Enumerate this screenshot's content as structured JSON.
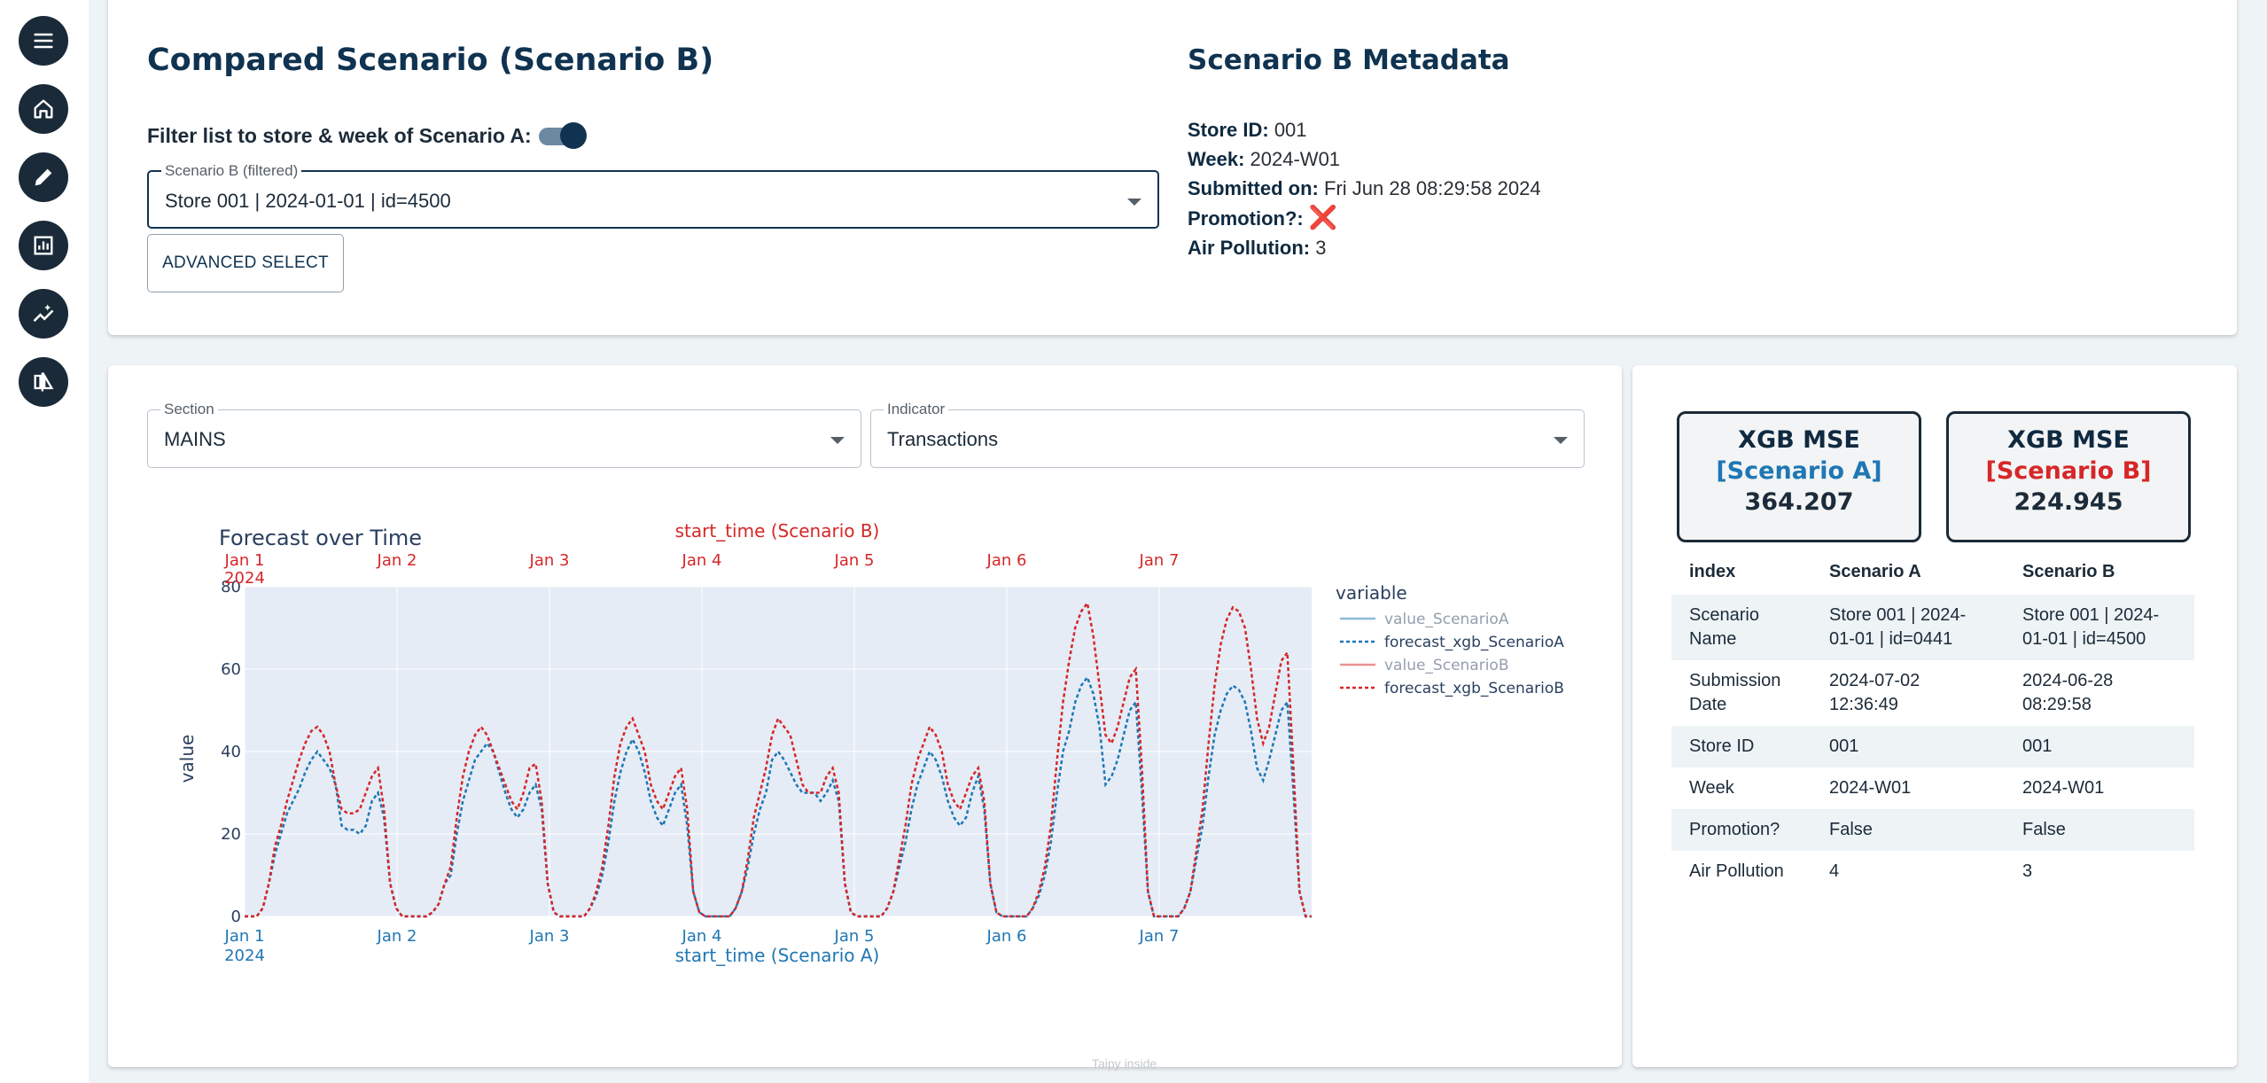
{
  "nav": {
    "items": [
      {
        "icon": "menu-icon"
      },
      {
        "icon": "home-icon"
      },
      {
        "icon": "pencil-icon"
      },
      {
        "icon": "report-icon"
      },
      {
        "icon": "sparkle-chart-icon"
      },
      {
        "icon": "compare-icon"
      }
    ]
  },
  "scenario_b": {
    "title": "Compared Scenario (Scenario B)",
    "filter_label": "Filter list to store & week of Scenario A:",
    "filter_on": true,
    "select_label": "Scenario B (filtered)",
    "select_value": "Store 001 | 2024-01-01 | id=4500",
    "advanced_button": "ADVANCED SELECT"
  },
  "metadata": {
    "title": "Scenario B Metadata",
    "fields": [
      {
        "key": "Store ID:",
        "value": "001"
      },
      {
        "key": "Week:",
        "value": "2024-W01"
      },
      {
        "key": "Submitted on:",
        "value": "Fri Jun 28 08:29:58 2024"
      },
      {
        "key": "Promotion?:",
        "value": "❌"
      },
      {
        "key": "Air Pollution:",
        "value": "3"
      }
    ]
  },
  "controls": {
    "section_label": "Section",
    "section_value": "MAINS",
    "indicator_label": "Indicator",
    "indicator_value": "Transactions"
  },
  "chart_data": {
    "type": "line",
    "title": "Forecast over Time",
    "xlabel_top": "start_time (Scenario B)",
    "xlabel_bottom": "start_time (Scenario A)",
    "ylabel": "value",
    "ylim": [
      0,
      80
    ],
    "yticks": [
      0,
      20,
      40,
      60,
      80
    ],
    "xticks": [
      "Jan 1",
      "Jan 2",
      "Jan 3",
      "Jan 4",
      "Jan 5",
      "Jan 6",
      "Jan 7"
    ],
    "xtick_year": "2024",
    "legend_title": "variable",
    "legend_position": "right",
    "grid": true,
    "colors": {
      "scenarioA": "#1f77b4",
      "scenarioB": "#d62728",
      "plot_bg": "#e5ecf6"
    },
    "series": [
      {
        "name": "value_ScenarioA",
        "dash": "solid",
        "color": "#1f77b4",
        "visible": false
      },
      {
        "name": "forecast_xgb_ScenarioA",
        "dash": "dot",
        "color": "#1f77b4",
        "visible": true,
        "values": [
          0,
          0,
          0,
          2,
          8,
          15,
          20,
          25,
          28,
          31,
          35,
          38,
          40,
          38,
          36,
          32,
          22,
          21,
          21,
          20,
          22,
          28,
          30,
          24,
          8,
          2,
          0,
          0,
          0,
          0,
          0,
          1,
          3,
          8,
          10,
          20,
          28,
          33,
          38,
          40,
          42,
          40,
          35,
          30,
          26,
          24,
          26,
          30,
          32,
          26,
          8,
          1,
          0,
          0,
          0,
          0,
          0,
          2,
          5,
          10,
          18,
          28,
          35,
          40,
          43,
          40,
          35,
          28,
          24,
          22,
          26,
          30,
          32,
          22,
          6,
          1,
          0,
          0,
          0,
          0,
          0,
          2,
          6,
          12,
          20,
          26,
          30,
          38,
          40,
          38,
          35,
          32,
          30,
          30,
          30,
          28,
          30,
          33,
          28,
          8,
          1,
          0,
          0,
          0,
          0,
          0,
          2,
          6,
          12,
          18,
          26,
          32,
          36,
          40,
          38,
          34,
          28,
          24,
          22,
          24,
          30,
          34,
          26,
          8,
          1,
          0,
          0,
          0,
          0,
          0,
          2,
          5,
          10,
          18,
          30,
          40,
          45,
          52,
          56,
          58,
          54,
          46,
          32,
          34,
          38,
          44,
          50,
          52,
          30,
          6,
          0,
          0,
          0,
          0,
          0,
          2,
          6,
          14,
          22,
          34,
          44,
          50,
          54,
          56,
          55,
          52,
          45,
          36,
          33,
          38,
          44,
          50,
          52,
          30,
          6,
          0,
          0
        ]
      },
      {
        "name": "value_ScenarioB",
        "dash": "solid",
        "color": "#d62728",
        "visible": false
      },
      {
        "name": "forecast_xgb_ScenarioB",
        "dash": "dot",
        "color": "#d62728",
        "visible": true,
        "values": [
          0,
          0,
          0,
          2,
          8,
          17,
          22,
          28,
          33,
          38,
          42,
          45,
          46,
          44,
          40,
          32,
          26,
          25,
          25,
          26,
          30,
          34,
          36,
          26,
          8,
          2,
          0,
          0,
          0,
          0,
          0,
          1,
          3,
          8,
          12,
          24,
          34,
          40,
          44,
          46,
          44,
          40,
          36,
          32,
          28,
          26,
          30,
          36,
          37,
          28,
          8,
          1,
          0,
          0,
          0,
          0,
          0,
          2,
          6,
          12,
          22,
          34,
          42,
          46,
          48,
          44,
          40,
          32,
          28,
          26,
          30,
          34,
          36,
          26,
          6,
          1,
          0,
          0,
          0,
          0,
          0,
          2,
          6,
          14,
          24,
          30,
          36,
          44,
          48,
          46,
          44,
          38,
          32,
          30,
          30,
          30,
          34,
          36,
          30,
          8,
          1,
          0,
          0,
          0,
          0,
          0,
          2,
          6,
          14,
          22,
          32,
          38,
          42,
          46,
          44,
          40,
          32,
          28,
          26,
          30,
          34,
          36,
          28,
          8,
          1,
          0,
          0,
          0,
          0,
          0,
          2,
          6,
          12,
          22,
          38,
          52,
          62,
          70,
          74,
          76,
          68,
          56,
          44,
          42,
          46,
          52,
          58,
          60,
          36,
          6,
          0,
          0,
          0,
          0,
          0,
          2,
          6,
          16,
          26,
          42,
          56,
          66,
          72,
          75,
          74,
          70,
          60,
          48,
          42,
          46,
          54,
          62,
          64,
          36,
          6,
          0,
          0
        ]
      }
    ]
  },
  "metrics": {
    "mse_label": "XGB MSE",
    "scenario_a_label": "[Scenario A]",
    "scenario_a_value": "364.207",
    "scenario_b_label": "[Scenario B]",
    "scenario_b_value": "224.945"
  },
  "comparison_table": {
    "headers": [
      "index",
      "Scenario A",
      "Scenario B"
    ],
    "rows": [
      [
        "Scenario Name",
        "Store 001 | 2024-01-01 | id=0441",
        "Store 001 | 2024-01-01 | id=4500"
      ],
      [
        "Submission Date",
        "2024-07-02 12:36:49",
        "2024-06-28 08:29:58"
      ],
      [
        "Store ID",
        "001",
        "001"
      ],
      [
        "Week",
        "2024-W01",
        "2024-W01"
      ],
      [
        "Promotion?",
        "False",
        "False"
      ],
      [
        "Air Pollution",
        "4",
        "3"
      ]
    ]
  },
  "footer": {
    "watermark": "Taipy inside"
  }
}
